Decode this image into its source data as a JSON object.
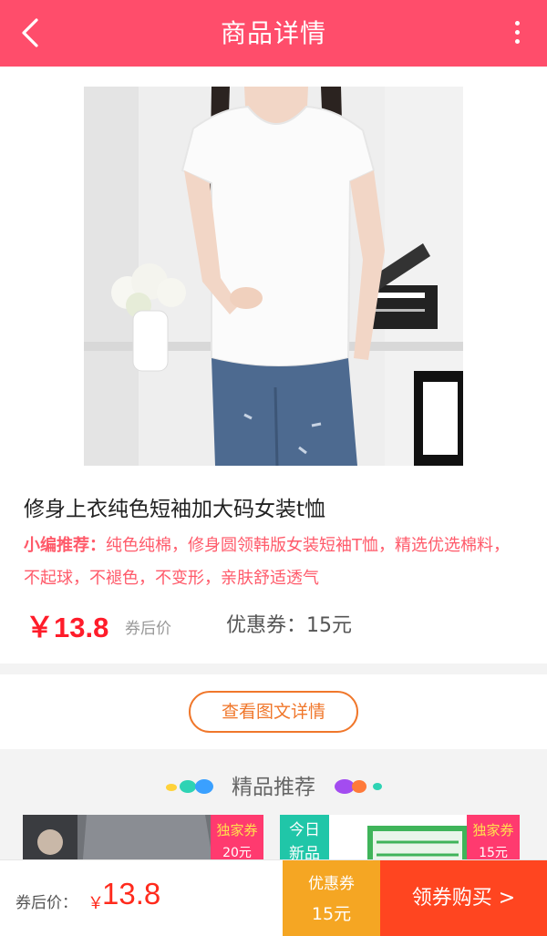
{
  "header": {
    "title": "商品详情",
    "back_icon": "chevron-left-icon",
    "more_icon": "more-vertical-icon",
    "background": "#ff4d6b"
  },
  "product": {
    "title": "修身上衣纯色短袖加大码女装t恤",
    "recommend_label": "小编推荐：",
    "recommend_text": "纯色纯棉，修身圆领韩版女装短袖T恤，精选优选棉料，不起球，不褪色，不变形，亲肤舒适透气",
    "price": "￥13.8",
    "price_note": "券后价",
    "coupon": "优惠券：15元"
  },
  "detail_button": "查看图文详情",
  "recommend_section": {
    "title": "精品推荐",
    "items": [
      {
        "badge_top": "独家券",
        "badge_bottom": "20元"
      },
      {
        "new_tag_line1": "今日",
        "new_tag_line2": "新品",
        "badge_top": "独家券",
        "badge_bottom": "15元"
      }
    ]
  },
  "bottom_bar": {
    "price_label": "券后价：",
    "currency": "￥",
    "price": "13.8",
    "coupon_line1": "优惠券",
    "coupon_line2": "15元",
    "buy_label": "领券购买 >"
  },
  "colors": {
    "accent": "#ff4d6b",
    "price_red": "#ff1c2a",
    "orange": "#f0772b",
    "coupon_yellow": "#f5a623",
    "buy_red": "#ff4520"
  }
}
